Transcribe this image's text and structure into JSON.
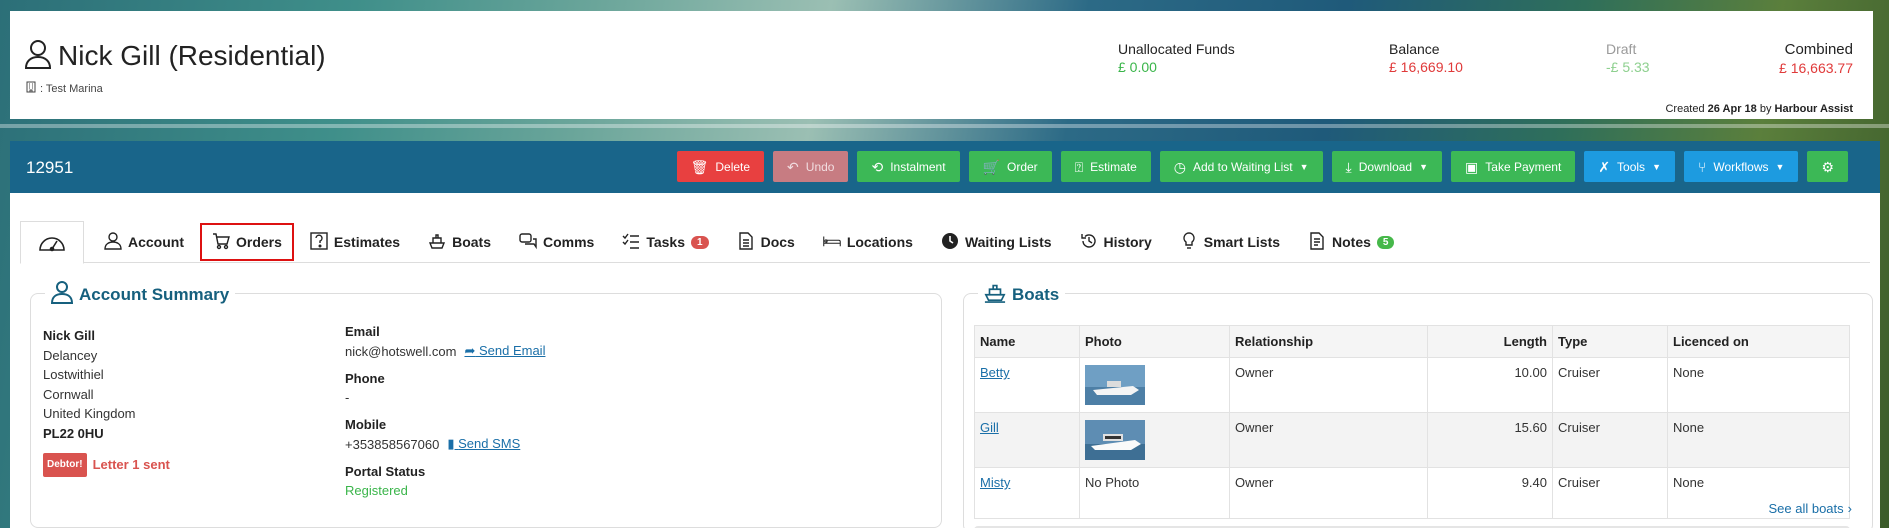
{
  "header": {
    "customer_name": "Nick Gill (Residential)",
    "marina": ": Test Marina",
    "funds": {
      "unallocated_label": "Unallocated Funds",
      "unallocated_value": "£ 0.00",
      "balance_label": "Balance",
      "balance_value": "£ 16,669.10",
      "draft_label": "Draft",
      "draft_value": "-£ 5.33",
      "combined_label": "Combined",
      "combined_value": "£ 16,663.77"
    },
    "created_prefix": "Created",
    "created_date": "26 Apr 18",
    "created_by_prefix": "by",
    "created_by": "Harbour Assist"
  },
  "account_bar": {
    "account_number": "12951",
    "buttons": {
      "delete": "Delete",
      "undo": "Undo",
      "instalment": "Instalment",
      "order": "Order",
      "estimate": "Estimate",
      "waiting_list": "Add to Waiting List",
      "download": "Download",
      "take_payment": "Take Payment",
      "tools": "Tools",
      "workflows": "Workflows"
    },
    "colors": {
      "bar": "#19658a",
      "red": "#e84040",
      "green": "#3cb856",
      "blue": "#1d9be0"
    }
  },
  "tabs": [
    {
      "label": "Account"
    },
    {
      "label": "Orders"
    },
    {
      "label": "Estimates"
    },
    {
      "label": "Boats"
    },
    {
      "label": "Comms"
    },
    {
      "label": "Tasks",
      "badge": "1"
    },
    {
      "label": "Docs"
    },
    {
      "label": "Locations"
    },
    {
      "label": "Waiting Lists"
    },
    {
      "label": "History"
    },
    {
      "label": "Smart Lists"
    },
    {
      "label": "Notes",
      "badge": "5"
    }
  ],
  "account_summary": {
    "title": "Account Summary",
    "name": "Nick Gill",
    "address": [
      "Delancey",
      "Lostwithiel",
      "Cornwall",
      "United Kingdom"
    ],
    "postcode": "PL22 0HU",
    "debtor_tag": "Debtor!",
    "debtor_status": "Letter 1 sent",
    "email_label": "Email",
    "email": "nick@hotswell.com",
    "send_email": "Send Email",
    "phone_label": "Phone",
    "phone": "-",
    "mobile_label": "Mobile",
    "mobile": "+353858567060",
    "send_sms": "Send SMS",
    "portal_label": "Portal Status",
    "portal_status": "Registered"
  },
  "boats": {
    "title": "Boats",
    "columns": [
      "Name",
      "Photo",
      "Relationship",
      "Length",
      "Type",
      "Licenced on"
    ],
    "rows": [
      {
        "name": "Betty",
        "photo": "",
        "relationship": "Owner",
        "length": "10.00",
        "type": "Cruiser",
        "licenced": "None"
      },
      {
        "name": "Gill",
        "photo": "",
        "relationship": "Owner",
        "length": "15.60",
        "type": "Cruiser",
        "licenced": "None"
      },
      {
        "name": "Misty",
        "photo": "No Photo",
        "relationship": "Owner",
        "length": "9.40",
        "type": "Cruiser",
        "licenced": "None"
      }
    ],
    "see_all": "See all boats"
  }
}
